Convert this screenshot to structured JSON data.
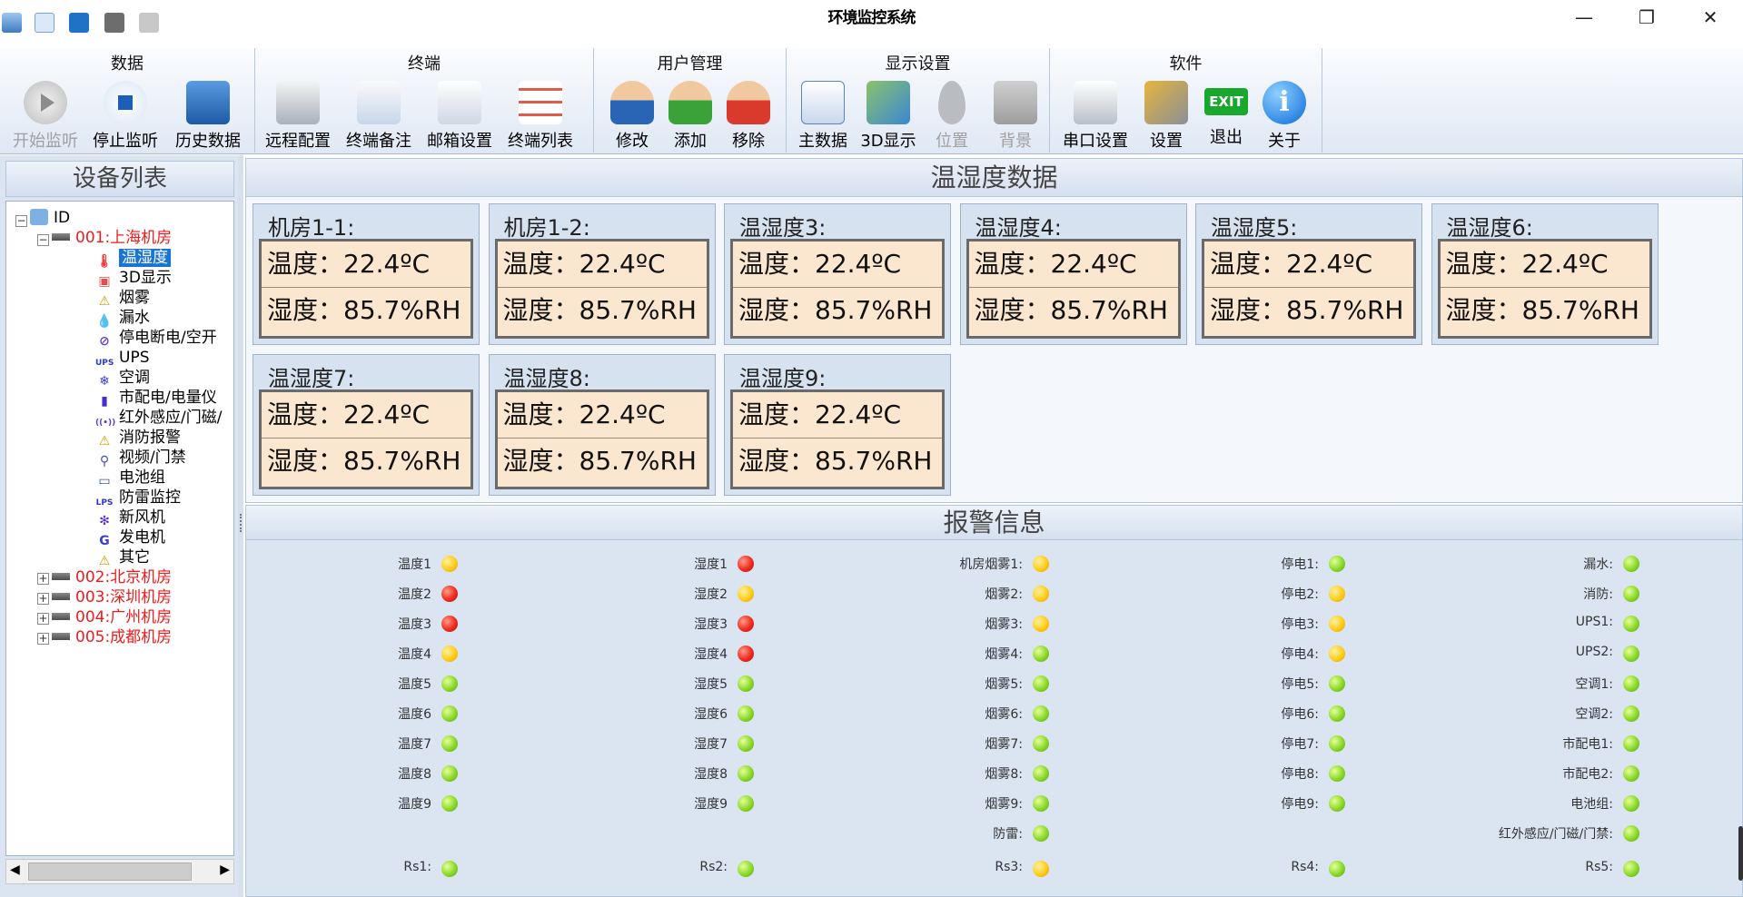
{
  "app": {
    "title": "环境监控系统"
  },
  "window_controls": {
    "minimize": "—",
    "maximize": "❐",
    "close": "✕"
  },
  "ribbon": {
    "groups": [
      {
        "title": "数据",
        "buttons": [
          "开始监听",
          "停止监听",
          "历史数据"
        ]
      },
      {
        "title": "终端",
        "buttons": [
          "远程配置",
          "终端备注",
          "邮箱设置",
          "终端列表"
        ]
      },
      {
        "title": "用户管理",
        "buttons": [
          "修改",
          "添加",
          "移除"
        ]
      },
      {
        "title": "显示设置",
        "buttons": [
          "主数据",
          "3D显示",
          "位置",
          "背景"
        ]
      },
      {
        "title": "软件",
        "buttons": [
          "串口设置",
          "设置",
          "退出",
          "关于"
        ]
      }
    ]
  },
  "device_list": {
    "title": "设备列表",
    "root": "ID",
    "rooms": [
      "001:上海机房",
      "002:北京机房",
      "003:深圳机房",
      "004:广州机房",
      "005:成都机房"
    ],
    "items": [
      "温湿度",
      "3D显示",
      "烟雾",
      "漏水",
      "停电断电/空开",
      "UPS",
      "空调",
      "市配电/电量仪",
      "红外感应/门磁/",
      "消防报警",
      "视频/门禁",
      "电池组",
      "防雷监控",
      "新风机",
      "发电机",
      "其它"
    ]
  },
  "temp_panel": {
    "title": "温湿度数据",
    "temp_label": "温度：",
    "hum_label": "湿度：",
    "cards": [
      {
        "name": "机房1-1:",
        "temp": "22.4ºC",
        "hum": "85.7%RH"
      },
      {
        "name": "机房1-2:",
        "temp": "22.4ºC",
        "hum": "85.7%RH"
      },
      {
        "name": "温湿度3:",
        "temp": "22.4ºC",
        "hum": "85.7%RH"
      },
      {
        "name": "温湿度4:",
        "temp": "22.4ºC",
        "hum": "85.7%RH"
      },
      {
        "name": "温湿度5:",
        "temp": "22.4ºC",
        "hum": "85.7%RH"
      },
      {
        "name": "温湿度6:",
        "temp": "22.4ºC",
        "hum": "85.7%RH"
      },
      {
        "name": "温湿度7:",
        "temp": "22.4ºC",
        "hum": "85.7%RH"
      },
      {
        "name": "温湿度8:",
        "temp": "22.4ºC",
        "hum": "85.7%RH"
      },
      {
        "name": "温湿度9:",
        "temp": "22.4ºC",
        "hum": "85.7%RH"
      }
    ]
  },
  "alarm_panel": {
    "title": "报警信息",
    "columns": [
      [
        [
          "温度1",
          "yellow"
        ],
        [
          "温度2",
          "red"
        ],
        [
          "温度3",
          "red"
        ],
        [
          "温度4",
          "yellow"
        ],
        [
          "温度5",
          "green"
        ],
        [
          "温度6",
          "green"
        ],
        [
          "温度7",
          "green"
        ],
        [
          "温度8",
          "green"
        ],
        [
          "温度9",
          "green"
        ],
        null,
        [
          "Rs1:",
          "green"
        ]
      ],
      [
        [
          "湿度1",
          "red"
        ],
        [
          "湿度2",
          "yellow"
        ],
        [
          "湿度3",
          "red"
        ],
        [
          "湿度4",
          "red"
        ],
        [
          "湿度5",
          "green"
        ],
        [
          "湿度6",
          "green"
        ],
        [
          "湿度7",
          "green"
        ],
        [
          "湿度8",
          "green"
        ],
        [
          "湿度9",
          "green"
        ],
        null,
        [
          "Rs2:",
          "green"
        ]
      ],
      [
        [
          "机房烟雾1:",
          "yellow"
        ],
        [
          "烟雾2:",
          "yellow"
        ],
        [
          "烟雾3:",
          "yellow"
        ],
        [
          "烟雾4:",
          "green"
        ],
        [
          "烟雾5:",
          "green"
        ],
        [
          "烟雾6:",
          "green"
        ],
        [
          "烟雾7:",
          "green"
        ],
        [
          "烟雾8:",
          "green"
        ],
        [
          "烟雾9:",
          "green"
        ],
        [
          "防雷:",
          "green"
        ],
        [
          "Rs3:",
          "yellow"
        ]
      ],
      [
        [
          "停电1:",
          "green"
        ],
        [
          "停电2:",
          "yellow"
        ],
        [
          "停电3:",
          "yellow"
        ],
        [
          "停电4:",
          "yellow"
        ],
        [
          "停电5:",
          "green"
        ],
        [
          "停电6:",
          "green"
        ],
        [
          "停电7:",
          "green"
        ],
        [
          "停电8:",
          "green"
        ],
        [
          "停电9:",
          "green"
        ],
        null,
        [
          "Rs4:",
          "green"
        ]
      ],
      [
        [
          "漏水:",
          "green"
        ],
        [
          "消防:",
          "green"
        ],
        [
          "UPS1:",
          "green"
        ],
        [
          "UPS2:",
          "green"
        ],
        [
          "空调1:",
          "green"
        ],
        [
          "空调2:",
          "green"
        ],
        [
          "市配电1:",
          "green"
        ],
        [
          "市配电2:",
          "green"
        ],
        [
          "电池组:",
          "green"
        ],
        [
          "红外感应/门磁/门禁:",
          "green"
        ],
        [
          "Rs5:",
          "green"
        ]
      ]
    ]
  }
}
